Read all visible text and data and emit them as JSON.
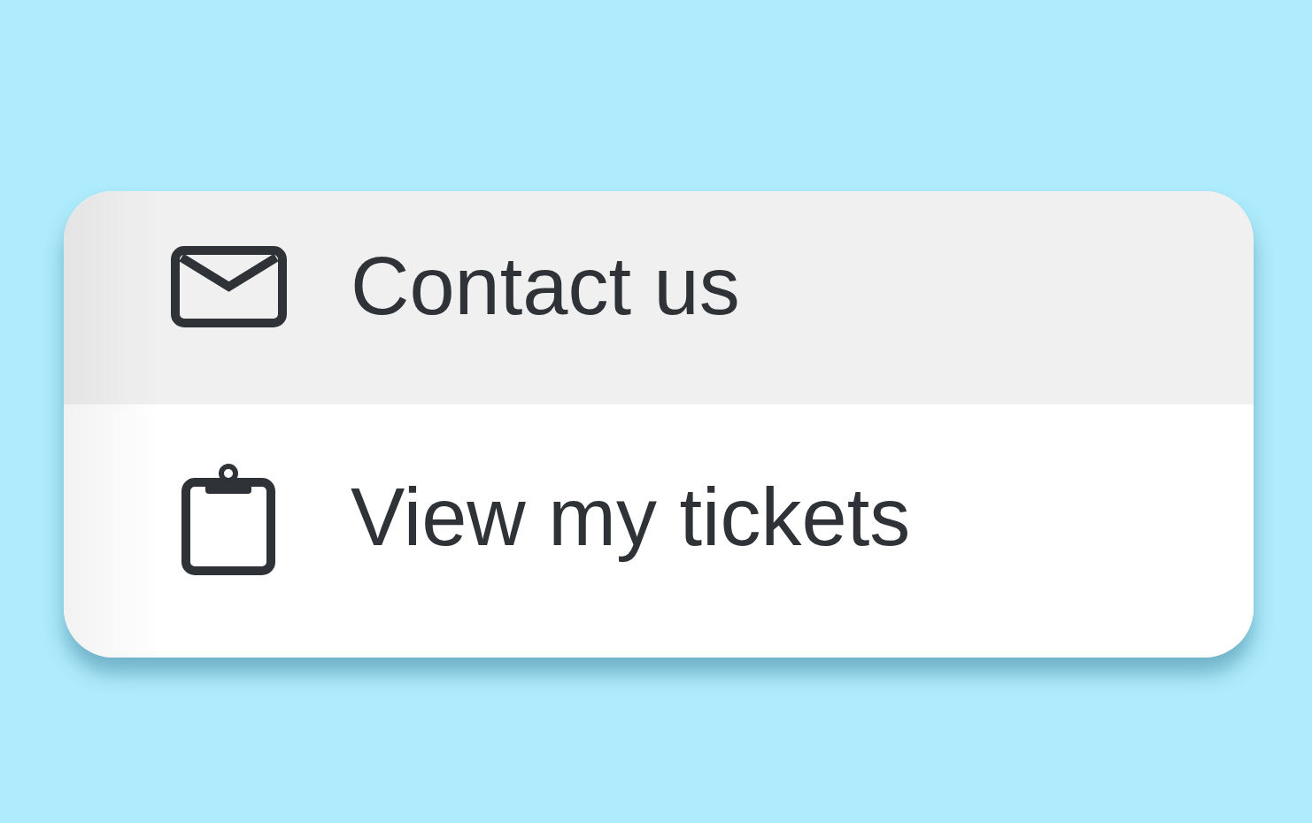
{
  "menu": {
    "items": [
      {
        "label": "Contact us",
        "selected": true
      },
      {
        "label": "View my tickets",
        "selected": false
      }
    ]
  }
}
